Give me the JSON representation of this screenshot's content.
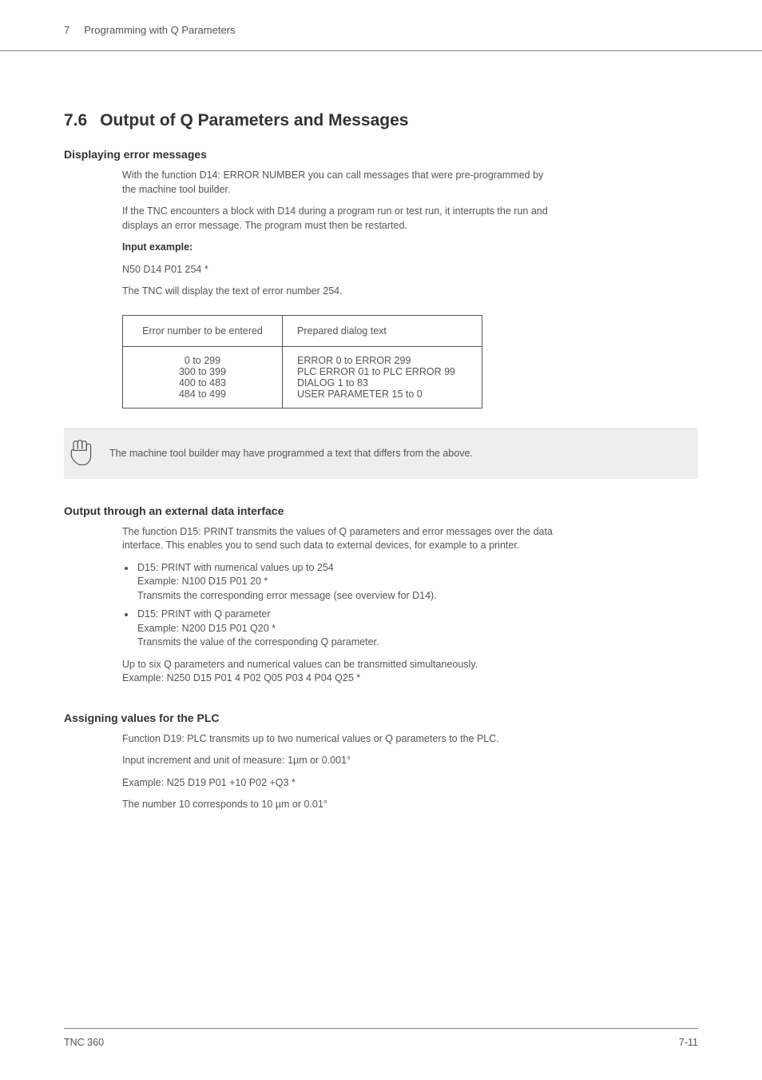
{
  "header": {
    "chapterNum": "7",
    "chapterTitle": "Programming with Q Parameters"
  },
  "section": {
    "num": "7.6",
    "title": "Output of Q Parameters and Messages"
  },
  "sub1": {
    "heading": "Displaying error messages",
    "p1": "With the function D14: ERROR NUMBER you can call messages that were pre-programmed by the machine tool builder.",
    "p2": "If the TNC encounters a block with D14 during a program run or test run, it interrupts the run and displays an error message. The program must then be restarted.",
    "inputExampleLabel": "Input example:",
    "inputExample": "N50 D14 P01 254 *",
    "p3": "The TNC will display the text of error number 254."
  },
  "table": {
    "h1": "Error number to be entered",
    "h2": "Prepared dialog text",
    "rows": [
      {
        "c1": "0 to 299",
        "c2": "ERROR 0 to ERROR 299"
      },
      {
        "c1": "300 to 399",
        "c2": "PLC ERROR 01 to PLC ERROR 99"
      },
      {
        "c1": "400 to 483",
        "c2": "DIALOG 1 to 83"
      },
      {
        "c1": "484 to 499",
        "c2": "USER PARAMETER 15 to 0"
      }
    ]
  },
  "note": {
    "text": "The machine tool builder may have programmed a text that differs from the above."
  },
  "sub2": {
    "heading": "Output through an external data interface",
    "p1": "The function D15: PRINT transmits the values of Q parameters and error messages over the data interface. This enables you to send such data to external devices, for example to a printer.",
    "b1a": "D15: PRINT with numerical values up to 254",
    "b1b": "Example: N100 D15 P01 20 *",
    "b1c": "Transmits the corresponding error message (see overview for D14).",
    "b2a": "D15: PRINT with Q parameter",
    "b2b": "Example: N200 D15 P01 Q20 *",
    "b2c": "Transmits the value of the corresponding Q parameter.",
    "p2a": "Up to six Q parameters and numerical values can be transmitted simultaneously.",
    "p2b": "Example: N250 D15 P01 4 P02 Q05 P03 4 P04 Q25 *"
  },
  "sub3": {
    "heading": "Assigning values for the PLC",
    "p1": "Function D19: PLC transmits up to two numerical values or Q parameters to the PLC.",
    "p2": "Input increment and unit of measure: 1µm or 0.001°",
    "p3": "Example: N25 D19 P01 +10 P02 +Q3 *",
    "p4": "The number 10 corresponds to 10 µm or 0.01°"
  },
  "footer": {
    "left": "TNC 360",
    "right": "7-11"
  }
}
